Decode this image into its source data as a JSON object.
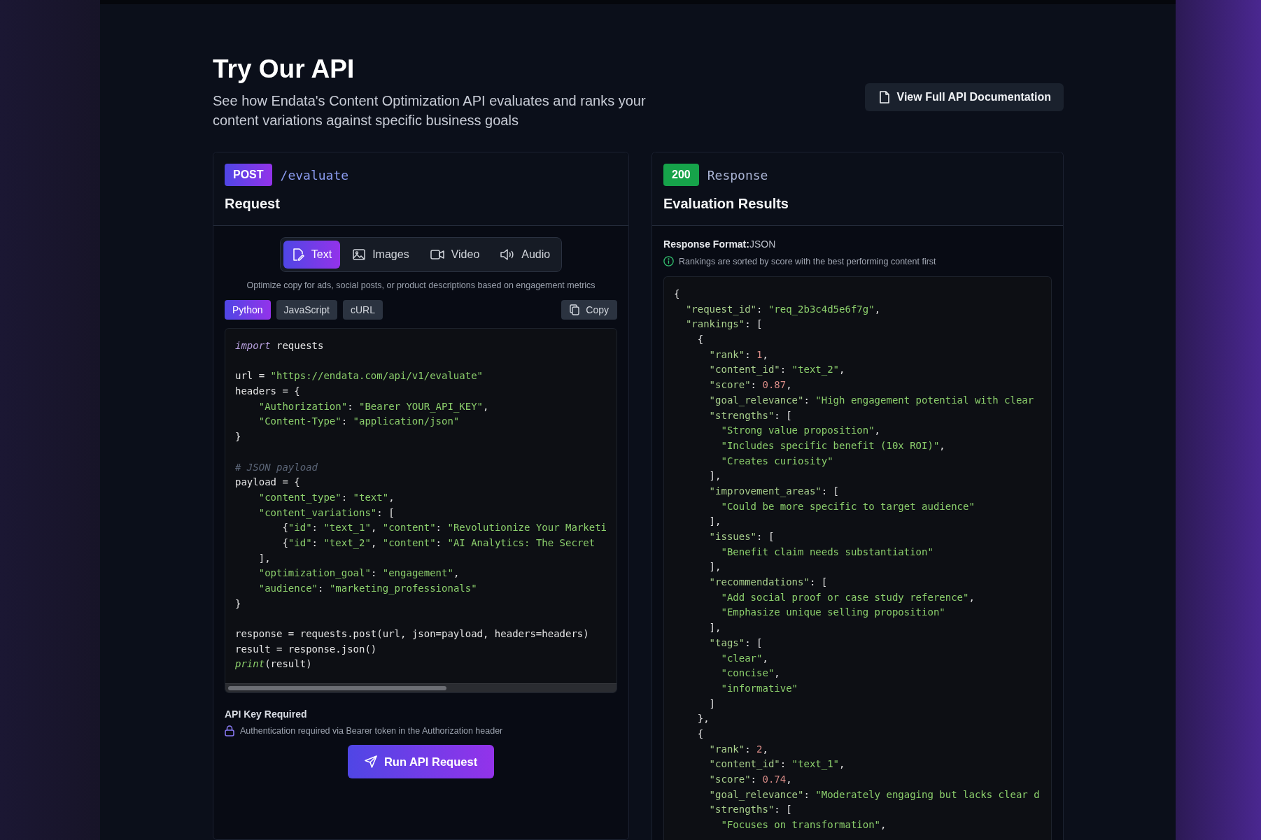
{
  "header": {
    "title": "Try Our API",
    "subtitle": "See how Endata's Content Optimization API evaluates and ranks your content variations against specific business goals",
    "docs_button": "View Full API Documentation"
  },
  "request_panel": {
    "method": "POST",
    "endpoint": "/evaluate",
    "title": "Request",
    "media_tabs": [
      {
        "label": "Text",
        "selected": true
      },
      {
        "label": "Images",
        "selected": false
      },
      {
        "label": "Video",
        "selected": false
      },
      {
        "label": "Audio",
        "selected": false
      }
    ],
    "description": "Optimize copy for ads, social posts, or product descriptions based on engagement metrics",
    "language_tabs": [
      {
        "label": "Python",
        "selected": true
      },
      {
        "label": "JavaScript",
        "selected": false
      },
      {
        "label": "cURL",
        "selected": false
      }
    ],
    "copy_button": "Copy",
    "code_lines": [
      {
        "kind": "code",
        "segments": [
          {
            "text": "import",
            "kind": "keyword"
          },
          {
            "text": " requests",
            "kind": "plain"
          }
        ]
      },
      {
        "kind": "blank"
      },
      {
        "kind": "code",
        "segments": [
          {
            "text": "url = ",
            "kind": "plain"
          },
          {
            "text": "\"https://endata.com/api/v1/evaluate\"",
            "kind": "string"
          }
        ]
      },
      {
        "kind": "code",
        "segments": [
          {
            "text": "headers = {",
            "kind": "plain"
          }
        ]
      },
      {
        "kind": "code",
        "segments": [
          {
            "text": "    \"Authorization\"",
            "kind": "string"
          },
          {
            "text": ": ",
            "kind": "plain"
          },
          {
            "text": "\"Bearer YOUR_API_KEY\"",
            "kind": "string"
          },
          {
            "text": ",",
            "kind": "plain"
          }
        ]
      },
      {
        "kind": "code",
        "segments": [
          {
            "text": "    \"Content-Type\"",
            "kind": "string"
          },
          {
            "text": ": ",
            "kind": "plain"
          },
          {
            "text": "\"application/json\"",
            "kind": "string"
          }
        ]
      },
      {
        "kind": "code",
        "segments": [
          {
            "text": "}",
            "kind": "plain"
          }
        ]
      },
      {
        "kind": "blank"
      },
      {
        "kind": "code",
        "segments": [
          {
            "text": "# JSON payload",
            "kind": "comment"
          }
        ]
      },
      {
        "kind": "code",
        "segments": [
          {
            "text": "payload = {",
            "kind": "plain"
          }
        ]
      },
      {
        "kind": "code",
        "segments": [
          {
            "text": "    \"content_type\"",
            "kind": "string"
          },
          {
            "text": ": ",
            "kind": "plain"
          },
          {
            "text": "\"text\"",
            "kind": "string"
          },
          {
            "text": ",",
            "kind": "plain"
          }
        ]
      },
      {
        "kind": "code",
        "segments": [
          {
            "text": "    \"content_variations\"",
            "kind": "string"
          },
          {
            "text": ": [",
            "kind": "plain"
          }
        ]
      },
      {
        "kind": "code",
        "segments": [
          {
            "text": "        {",
            "kind": "plain"
          },
          {
            "text": "\"id\"",
            "kind": "string"
          },
          {
            "text": ": ",
            "kind": "plain"
          },
          {
            "text": "\"text_1\"",
            "kind": "string"
          },
          {
            "text": ", ",
            "kind": "plain"
          },
          {
            "text": "\"content\"",
            "kind": "string"
          },
          {
            "text": ": ",
            "kind": "plain"
          },
          {
            "text": "\"Revolutionize Your Marketi",
            "kind": "string"
          }
        ]
      },
      {
        "kind": "code",
        "segments": [
          {
            "text": "        {",
            "kind": "plain"
          },
          {
            "text": "\"id\"",
            "kind": "string"
          },
          {
            "text": ": ",
            "kind": "plain"
          },
          {
            "text": "\"text_2\"",
            "kind": "string"
          },
          {
            "text": ", ",
            "kind": "plain"
          },
          {
            "text": "\"content\"",
            "kind": "string"
          },
          {
            "text": ": ",
            "kind": "plain"
          },
          {
            "text": "\"AI Analytics: The Secret",
            "kind": "string"
          }
        ]
      },
      {
        "kind": "code",
        "segments": [
          {
            "text": "    ],",
            "kind": "plain"
          }
        ]
      },
      {
        "kind": "code",
        "segments": [
          {
            "text": "    \"optimization_goal\"",
            "kind": "string"
          },
          {
            "text": ": ",
            "kind": "plain"
          },
          {
            "text": "\"engagement\"",
            "kind": "string"
          },
          {
            "text": ",",
            "kind": "plain"
          }
        ]
      },
      {
        "kind": "code",
        "segments": [
          {
            "text": "    \"audience\"",
            "kind": "string"
          },
          {
            "text": ": ",
            "kind": "plain"
          },
          {
            "text": "\"marketing_professionals\"",
            "kind": "string"
          }
        ]
      },
      {
        "kind": "code",
        "segments": [
          {
            "text": "}",
            "kind": "plain"
          }
        ]
      },
      {
        "kind": "blank"
      },
      {
        "kind": "code",
        "segments": [
          {
            "text": "response = requests.post(url, json=payload, headers=headers)",
            "kind": "plain"
          }
        ]
      },
      {
        "kind": "code",
        "segments": [
          {
            "text": "result = response.json()",
            "kind": "plain"
          }
        ]
      },
      {
        "kind": "code",
        "segments": [
          {
            "text": "print",
            "kind": "builtin"
          },
          {
            "text": "(result)",
            "kind": "plain"
          }
        ]
      }
    ],
    "auth_title": "API Key Required",
    "auth_note": "Authentication required via Bearer token in the Authorization header",
    "run_button": "Run API Request"
  },
  "response_panel": {
    "status": "200",
    "label": "Response",
    "title": "Evaluation Results",
    "format_line": "**Response Format:**JSON",
    "info_note": "Rankings are sorted by score with the best performing content first",
    "json_lines": [
      {
        "kind": "code",
        "segments": [
          {
            "text": "{",
            "kind": "plain"
          }
        ]
      },
      {
        "kind": "code",
        "segments": [
          {
            "text": "  \"request_id\"",
            "kind": "key"
          },
          {
            "text": ": ",
            "kind": "plain"
          },
          {
            "text": "\"req_2b3c4d5e6f7g\"",
            "kind": "string"
          },
          {
            "text": ",",
            "kind": "plain"
          }
        ]
      },
      {
        "kind": "code",
        "segments": [
          {
            "text": "  \"rankings\"",
            "kind": "key"
          },
          {
            "text": ": [",
            "kind": "plain"
          }
        ]
      },
      {
        "kind": "code",
        "segments": [
          {
            "text": "    {",
            "kind": "plain"
          }
        ]
      },
      {
        "kind": "code",
        "segments": [
          {
            "text": "      \"rank\"",
            "kind": "key"
          },
          {
            "text": ": ",
            "kind": "plain"
          },
          {
            "text": "1",
            "kind": "number"
          },
          {
            "text": ",",
            "kind": "plain"
          }
        ]
      },
      {
        "kind": "code",
        "segments": [
          {
            "text": "      \"content_id\"",
            "kind": "key"
          },
          {
            "text": ": ",
            "kind": "plain"
          },
          {
            "text": "\"text_2\"",
            "kind": "string"
          },
          {
            "text": ",",
            "kind": "plain"
          }
        ]
      },
      {
        "kind": "code",
        "segments": [
          {
            "text": "      \"score\"",
            "kind": "key"
          },
          {
            "text": ": ",
            "kind": "plain"
          },
          {
            "text": "0.87",
            "kind": "number"
          },
          {
            "text": ",",
            "kind": "plain"
          }
        ]
      },
      {
        "kind": "code",
        "segments": [
          {
            "text": "      \"goal_relevance\"",
            "kind": "key"
          },
          {
            "text": ": ",
            "kind": "plain"
          },
          {
            "text": "\"High engagement potential with clear",
            "kind": "string"
          }
        ]
      },
      {
        "kind": "code",
        "segments": [
          {
            "text": "      \"strengths\"",
            "kind": "key"
          },
          {
            "text": ": [",
            "kind": "plain"
          }
        ]
      },
      {
        "kind": "code",
        "segments": [
          {
            "text": "        \"Strong value proposition\"",
            "kind": "string"
          },
          {
            "text": ",",
            "kind": "plain"
          }
        ]
      },
      {
        "kind": "code",
        "segments": [
          {
            "text": "        \"Includes specific benefit (10x ROI)\"",
            "kind": "string"
          },
          {
            "text": ",",
            "kind": "plain"
          }
        ]
      },
      {
        "kind": "code",
        "segments": [
          {
            "text": "        \"Creates curiosity\"",
            "kind": "string"
          }
        ]
      },
      {
        "kind": "code",
        "segments": [
          {
            "text": "      ],",
            "kind": "plain"
          }
        ]
      },
      {
        "kind": "code",
        "segments": [
          {
            "text": "      \"improvement_areas\"",
            "kind": "key"
          },
          {
            "text": ": [",
            "kind": "plain"
          }
        ]
      },
      {
        "kind": "code",
        "segments": [
          {
            "text": "        \"Could be more specific to target audience\"",
            "kind": "string"
          }
        ]
      },
      {
        "kind": "code",
        "segments": [
          {
            "text": "      ],",
            "kind": "plain"
          }
        ]
      },
      {
        "kind": "code",
        "segments": [
          {
            "text": "      \"issues\"",
            "kind": "key"
          },
          {
            "text": ": [",
            "kind": "plain"
          }
        ]
      },
      {
        "kind": "code",
        "segments": [
          {
            "text": "        \"Benefit claim needs substantiation\"",
            "kind": "string"
          }
        ]
      },
      {
        "kind": "code",
        "segments": [
          {
            "text": "      ],",
            "kind": "plain"
          }
        ]
      },
      {
        "kind": "code",
        "segments": [
          {
            "text": "      \"recommendations\"",
            "kind": "key"
          },
          {
            "text": ": [",
            "kind": "plain"
          }
        ]
      },
      {
        "kind": "code",
        "segments": [
          {
            "text": "        \"Add social proof or case study reference\"",
            "kind": "string"
          },
          {
            "text": ",",
            "kind": "plain"
          }
        ]
      },
      {
        "kind": "code",
        "segments": [
          {
            "text": "        \"Emphasize unique selling proposition\"",
            "kind": "string"
          }
        ]
      },
      {
        "kind": "code",
        "segments": [
          {
            "text": "      ],",
            "kind": "plain"
          }
        ]
      },
      {
        "kind": "code",
        "segments": [
          {
            "text": "      \"tags\"",
            "kind": "key"
          },
          {
            "text": ": [",
            "kind": "plain"
          }
        ]
      },
      {
        "kind": "code",
        "segments": [
          {
            "text": "        \"clear\"",
            "kind": "string"
          },
          {
            "text": ",",
            "kind": "plain"
          }
        ]
      },
      {
        "kind": "code",
        "segments": [
          {
            "text": "        \"concise\"",
            "kind": "string"
          },
          {
            "text": ",",
            "kind": "plain"
          }
        ]
      },
      {
        "kind": "code",
        "segments": [
          {
            "text": "        \"informative\"",
            "kind": "string"
          }
        ]
      },
      {
        "kind": "code",
        "segments": [
          {
            "text": "      ]",
            "kind": "plain"
          }
        ]
      },
      {
        "kind": "code",
        "segments": [
          {
            "text": "    },",
            "kind": "plain"
          }
        ]
      },
      {
        "kind": "code",
        "segments": [
          {
            "text": "    {",
            "kind": "plain"
          }
        ]
      },
      {
        "kind": "code",
        "segments": [
          {
            "text": "      \"rank\"",
            "kind": "key"
          },
          {
            "text": ": ",
            "kind": "plain"
          },
          {
            "text": "2",
            "kind": "number"
          },
          {
            "text": ",",
            "kind": "plain"
          }
        ]
      },
      {
        "kind": "code",
        "segments": [
          {
            "text": "      \"content_id\"",
            "kind": "key"
          },
          {
            "text": ": ",
            "kind": "plain"
          },
          {
            "text": "\"text_1\"",
            "kind": "string"
          },
          {
            "text": ",",
            "kind": "plain"
          }
        ]
      },
      {
        "kind": "code",
        "segments": [
          {
            "text": "      \"score\"",
            "kind": "key"
          },
          {
            "text": ": ",
            "kind": "plain"
          },
          {
            "text": "0.74",
            "kind": "number"
          },
          {
            "text": ",",
            "kind": "plain"
          }
        ]
      },
      {
        "kind": "code",
        "segments": [
          {
            "text": "      \"goal_relevance\"",
            "kind": "key"
          },
          {
            "text": ": ",
            "kind": "plain"
          },
          {
            "text": "\"Moderately engaging but lacks clear d",
            "kind": "string"
          }
        ]
      },
      {
        "kind": "code",
        "segments": [
          {
            "text": "      \"strengths\"",
            "kind": "key"
          },
          {
            "text": ": [",
            "kind": "plain"
          }
        ]
      },
      {
        "kind": "code",
        "segments": [
          {
            "text": "        \"Focuses on transformation\"",
            "kind": "string"
          },
          {
            "text": ",",
            "kind": "plain"
          }
        ]
      }
    ]
  }
}
